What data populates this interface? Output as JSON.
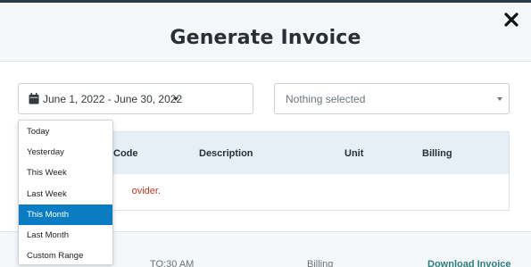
{
  "modal": {
    "title": "Generate Invoice",
    "close_icon": "close-icon"
  },
  "filters": {
    "date_range": {
      "icon": "calendar-icon",
      "value": "June 1, 2022 - June 30, 2022"
    },
    "provider": {
      "placeholder": "Nothing selected"
    }
  },
  "table": {
    "columns": [
      "Code",
      "Description",
      "Unit",
      "Billing"
    ],
    "empty_message": "ovider."
  },
  "range_menu": {
    "items": [
      "Today",
      "Yesterday",
      "This Week",
      "Last Week",
      "This Month",
      "Last Month",
      "Custom Range"
    ],
    "selected": "This Month",
    "highlight_color": "#0a7cc1"
  },
  "background_row": {
    "cells": [
      "TO:30 AM",
      "Billing",
      "Download Invoice"
    ]
  },
  "colors": {
    "header_bg": "#f4f8fb",
    "table_head_bg": "#e6eef6",
    "error_text": "#c0392b",
    "link": "#2e7d7a"
  }
}
